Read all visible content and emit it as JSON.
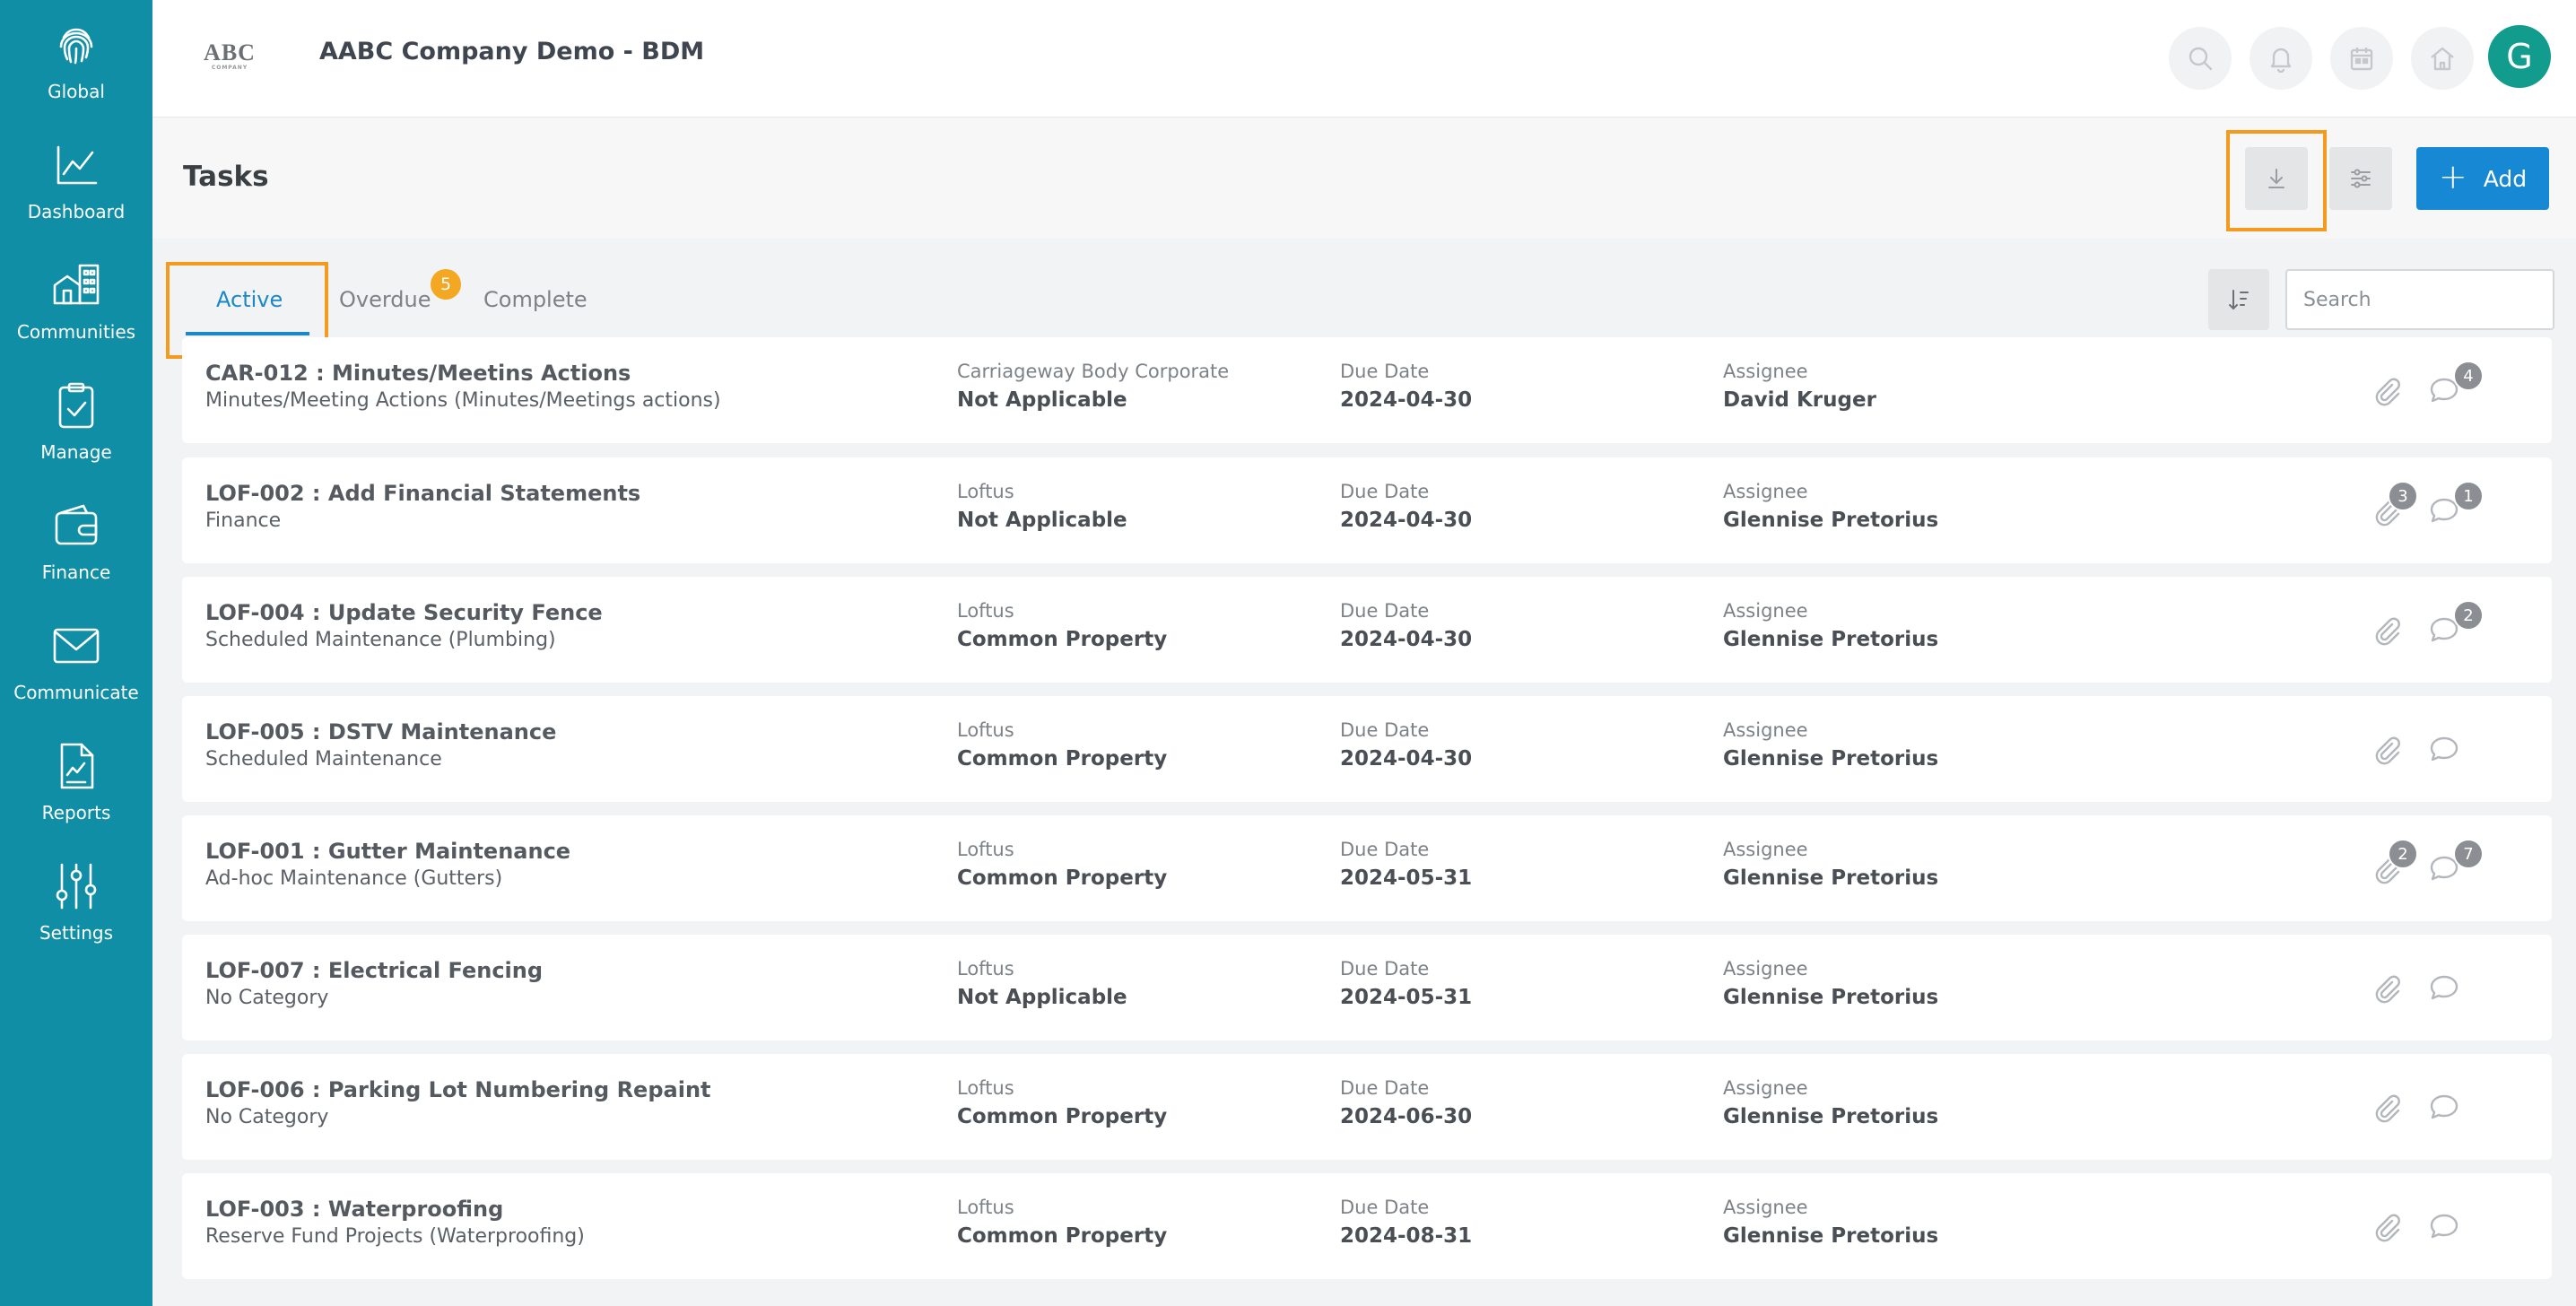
{
  "app": {
    "logo": "ABC",
    "logo_sub": "COMPANY",
    "title": "AABC Company Demo - BDM",
    "avatar_initial": "G"
  },
  "sidebar": {
    "items": [
      {
        "label": "Global",
        "icon": "fingerprint-icon"
      },
      {
        "label": "Dashboard",
        "icon": "chart-line-icon"
      },
      {
        "label": "Communities",
        "icon": "buildings-icon"
      },
      {
        "label": "Manage",
        "icon": "clipboard-check-icon"
      },
      {
        "label": "Finance",
        "icon": "wallet-icon"
      },
      {
        "label": "Communicate",
        "icon": "envelope-icon"
      },
      {
        "label": "Reports",
        "icon": "report-icon"
      },
      {
        "label": "Settings",
        "icon": "sliders-icon"
      }
    ]
  },
  "page": {
    "title": "Tasks",
    "add_label": "Add",
    "search_placeholder": "Search"
  },
  "tabs": [
    {
      "label": "Active",
      "active": true
    },
    {
      "label": "Overdue",
      "badge": "5"
    },
    {
      "label": "Complete"
    }
  ],
  "labels": {
    "due_date": "Due Date",
    "assignee": "Assignee"
  },
  "tasks": [
    {
      "title": "CAR-012 : Minutes/Meetins Actions",
      "category": "Minutes/Meeting Actions (Minutes/Meetings actions)",
      "community": "Carriageway Body Corporate",
      "area": "Not Applicable",
      "due": "2024-04-30",
      "assignee": "David Kruger",
      "attachments": "",
      "comments": "4"
    },
    {
      "title": "LOF-002 : Add Financial Statements",
      "category": "Finance",
      "community": "Loftus",
      "area": "Not Applicable",
      "due": "2024-04-30",
      "assignee": "Glennise Pretorius",
      "attachments": "3",
      "comments": "1"
    },
    {
      "title": "LOF-004 : Update Security Fence",
      "category": "Scheduled Maintenance (Plumbing)",
      "community": "Loftus",
      "area": "Common Property",
      "due": "2024-04-30",
      "assignee": "Glennise Pretorius",
      "attachments": "",
      "comments": "2"
    },
    {
      "title": "LOF-005 : DSTV Maintenance",
      "category": "Scheduled Maintenance",
      "community": "Loftus",
      "area": "Common Property",
      "due": "2024-04-30",
      "assignee": "Glennise Pretorius",
      "attachments": "",
      "comments": ""
    },
    {
      "title": "LOF-001 : Gutter Maintenance",
      "category": "Ad-hoc Maintenance (Gutters)",
      "community": "Loftus",
      "area": "Common Property",
      "due": "2024-05-31",
      "assignee": "Glennise Pretorius",
      "attachments": "2",
      "comments": "7"
    },
    {
      "title": "LOF-007 : Electrical Fencing",
      "category": "No Category",
      "community": "Loftus",
      "area": "Not Applicable",
      "due": "2024-05-31",
      "assignee": "Glennise Pretorius",
      "attachments": "",
      "comments": ""
    },
    {
      "title": "LOF-006 : Parking Lot Numbering Repaint",
      "category": "No Category",
      "community": "Loftus",
      "area": "Common Property",
      "due": "2024-06-30",
      "assignee": "Glennise Pretorius",
      "attachments": "",
      "comments": ""
    },
    {
      "title": "LOF-003 : Waterproofing",
      "category": "Reserve Fund Projects (Waterproofing)",
      "community": "Loftus",
      "area": "Common Property",
      "due": "2024-08-31",
      "assignee": "Glennise Pretorius",
      "attachments": "",
      "comments": ""
    }
  ],
  "colors": {
    "sidebar": "#0f8ea6",
    "accent": "#1788d4",
    "highlight": "#f39a1f",
    "badge": "#f4a722",
    "avatar": "#129c8e"
  }
}
